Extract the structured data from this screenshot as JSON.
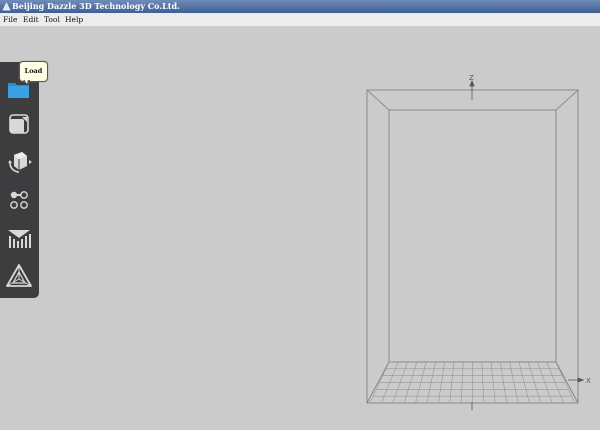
{
  "window": {
    "title": "Beijing Dazzle 3D Technology Co.Ltd."
  },
  "menu": {
    "items": [
      "File",
      "Edit",
      "Tool",
      "Help"
    ]
  },
  "toolbar": {
    "tools": [
      {
        "name": "load",
        "icon": "folder-icon"
      },
      {
        "name": "scale",
        "icon": "scale-icon"
      },
      {
        "name": "rotate",
        "icon": "rotate-icon"
      },
      {
        "name": "copy",
        "icon": "copy-icon"
      },
      {
        "name": "slice",
        "icon": "slice-icon"
      },
      {
        "name": "print",
        "icon": "print-icon"
      }
    ],
    "tooltip": "Load"
  },
  "viewport": {
    "z_axis_label": "Z",
    "x_axis_label": "X"
  },
  "colors": {
    "background": "#cbcbcb",
    "toolbar": "#3d3d3f",
    "accent": "#2a8fd6"
  }
}
